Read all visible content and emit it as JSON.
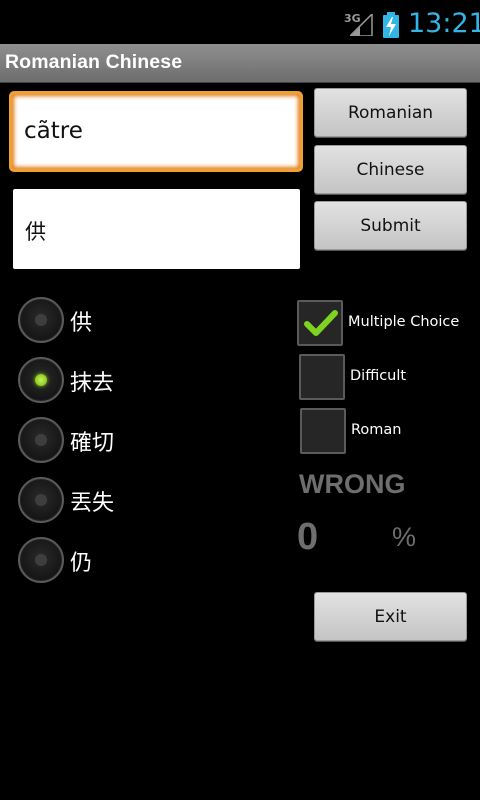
{
  "status_bar": {
    "network": "3G",
    "time": "13:21",
    "time_color": "#33b5e5"
  },
  "title": "Romanian Chinese",
  "word_field": {
    "value": "cãtre"
  },
  "answer_field": {
    "value": "供"
  },
  "buttons": {
    "romanian": "Romanian",
    "chinese": "Chinese",
    "submit": "Submit",
    "exit": "Exit"
  },
  "options": [
    {
      "label": "供",
      "selected": false
    },
    {
      "label": "抹去",
      "selected": true
    },
    {
      "label": "確切",
      "selected": false
    },
    {
      "label": "丟失",
      "selected": false
    },
    {
      "label": "仍",
      "selected": false
    }
  ],
  "checkboxes": [
    {
      "label": "Multiple Choice",
      "checked": true
    },
    {
      "label": "Difficult",
      "checked": false
    },
    {
      "label": "Roman",
      "checked": false
    }
  ],
  "result": "WRONG",
  "score": {
    "value": "0",
    "unit": "%"
  },
  "colors": {
    "accent_orange": "#f0a030",
    "radio_selected": "#8ccc1c",
    "check_green": "#7ed321"
  },
  "icons": [
    "signal-icon",
    "battery-charging-icon",
    "checkmark-icon"
  ]
}
